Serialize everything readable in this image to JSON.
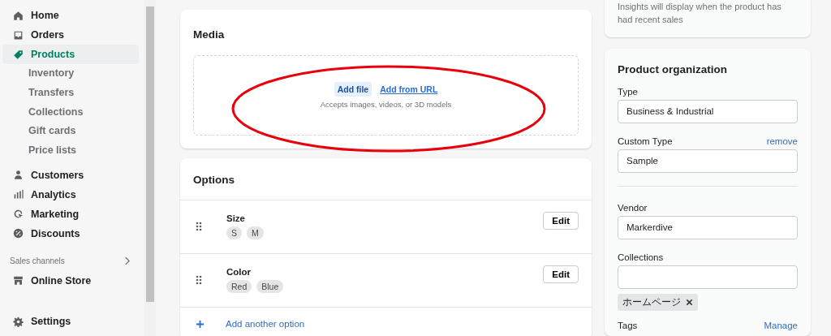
{
  "sidebar": {
    "items": [
      {
        "label": "Home",
        "selected": false
      },
      {
        "label": "Orders",
        "selected": false
      },
      {
        "label": "Products",
        "selected": true,
        "children": [
          {
            "label": "Inventory"
          },
          {
            "label": "Transfers"
          },
          {
            "label": "Collections"
          },
          {
            "label": "Gift cards"
          },
          {
            "label": "Price lists"
          }
        ]
      },
      {
        "label": "Customers",
        "selected": false
      },
      {
        "label": "Analytics",
        "selected": false
      },
      {
        "label": "Marketing",
        "selected": false
      },
      {
        "label": "Discounts",
        "selected": false
      }
    ],
    "section": {
      "label": "Sales channels"
    },
    "channels": [
      {
        "label": "Online Store"
      }
    ],
    "settings": {
      "label": "Settings"
    }
  },
  "media": {
    "title": "Media",
    "add_file": "Add file",
    "add_url": "Add from URL",
    "hint": "Accepts images, videos, or 3D models",
    "highlight": {
      "kind": "ellipse"
    }
  },
  "options": {
    "title": "Options",
    "rows": [
      {
        "name": "Size",
        "values": [
          "S",
          "M"
        ],
        "button": "Edit"
      },
      {
        "name": "Color",
        "values": [
          "Red",
          "Blue"
        ],
        "button": "Edit"
      }
    ],
    "add": "Add another option"
  },
  "insights": {
    "text": "Insights will display when the product has had recent sales"
  },
  "organization": {
    "title": "Product organization",
    "type_label": "Type",
    "type_value": "Business & Industrial",
    "custom_label": "Custom Type",
    "custom_action": "remove",
    "custom_value": "Sample",
    "vendor_label": "Vendor",
    "vendor_value": "Markerdive",
    "collections_label": "Collections",
    "collection_tags": [
      "ホームページ"
    ],
    "tags_label": "Tags",
    "tags_action": "Manage"
  }
}
